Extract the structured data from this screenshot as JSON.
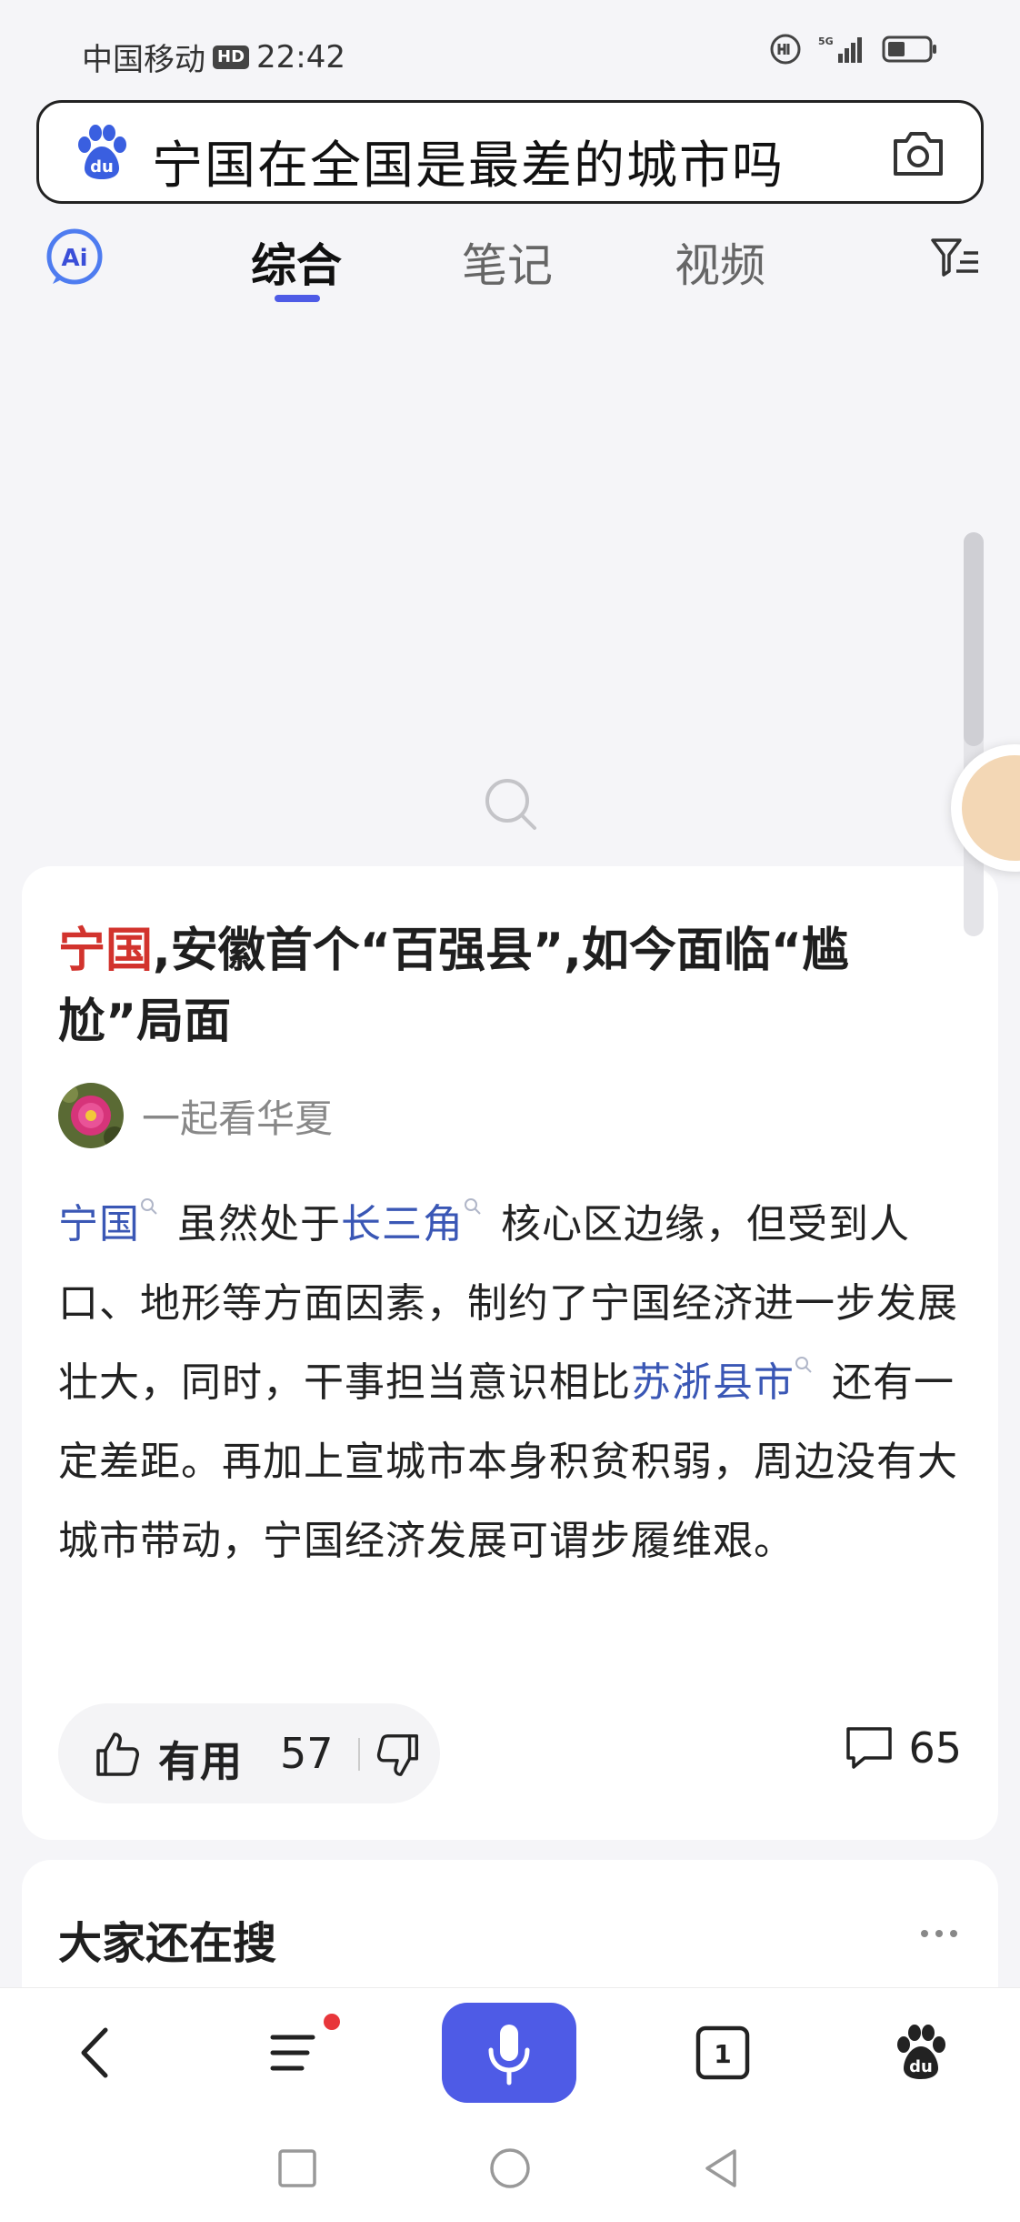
{
  "status_bar": {
    "carrier": "中国移动",
    "hd": "HD",
    "time": "22:42",
    "network": "5G"
  },
  "search": {
    "query": "宁国在全国是最差的城市吗"
  },
  "tabs": [
    {
      "label": "综合",
      "active": true
    },
    {
      "label": "笔记",
      "active": false
    },
    {
      "label": "视频",
      "active": false
    }
  ],
  "result": {
    "title_highlight": "宁国",
    "title_rest": ",安徽首个“百强县”,如今面临“尴尬”局面",
    "author": "一起看华夏",
    "body": {
      "link1": "宁国",
      "text1": " 虽然处于",
      "link2": "长三角",
      "text2": " 核心区边缘，但受到人口、地形等方面因素，制约了宁国经济进一步发展壮大，同时，干事担当意识相比",
      "link3": "苏浙县市",
      "text3": " 还有一定差距。再加上宣城市本身积贫积弱，周边没有大城市带动，宁国经济发展可谓步履维艰。"
    },
    "useful_label": "有用",
    "useful_count": "57",
    "comment_count": "65"
  },
  "related": {
    "heading": "大家还在搜"
  },
  "bottom_bar": {
    "tab_count": "1"
  },
  "colors": {
    "accent": "#4e5be6",
    "link": "#3a57b5",
    "title_highlight": "#d2332d",
    "badge": "#e8363b"
  }
}
